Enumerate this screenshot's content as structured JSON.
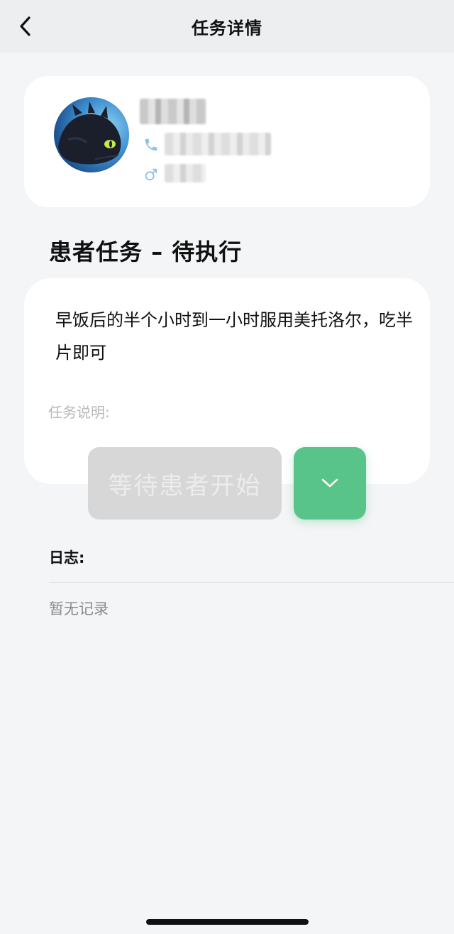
{
  "navbar": {
    "title": "任务详情",
    "back_icon": "chevron-left-icon"
  },
  "patient": {
    "avatar": "avatar-image",
    "name": "",
    "phone": "",
    "gender_icon": "male-icon",
    "phone_icon": "phone-icon",
    "icon_color": "#8fc3e6"
  },
  "task": {
    "section_title": "患者任务 – 待执行",
    "content": "早饭后的半个小时到一小时服用美托洛尔，吃半片即可",
    "description_label": "任务说明:"
  },
  "actions": {
    "wait_label": "等待患者开始",
    "toggle_icon": "chevron-down-icon",
    "accent": "#59c48a"
  },
  "log": {
    "label": "日志:",
    "empty_text": "暂无记录"
  }
}
